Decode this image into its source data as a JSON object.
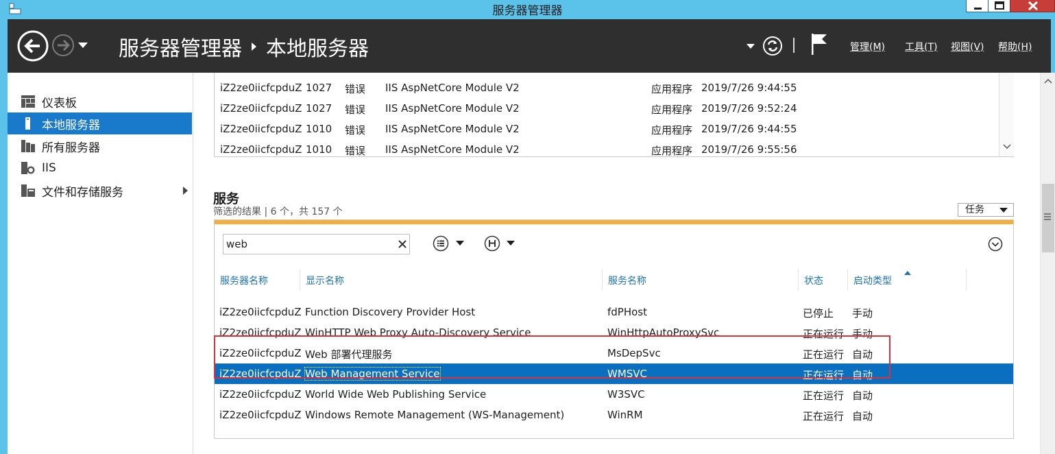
{
  "window": {
    "title": "服务器管理器"
  },
  "header": {
    "breadcrumb_root": "服务器管理器",
    "breadcrumb_current": "本地服务器",
    "menu": [
      {
        "label": "管理(M)"
      },
      {
        "label": "工具(T)"
      },
      {
        "label": "视图(V)"
      },
      {
        "label": "帮助(H)"
      }
    ]
  },
  "sidebar": {
    "items": [
      {
        "label": "仪表板",
        "icon": "dashboard-icon"
      },
      {
        "label": "本地服务器",
        "icon": "local-server-icon",
        "active": true
      },
      {
        "label": "所有服务器",
        "icon": "all-servers-icon"
      },
      {
        "label": "IIS",
        "icon": "iis-icon"
      },
      {
        "label": "文件和存储服务",
        "icon": "file-storage-icon",
        "expandable": true
      }
    ]
  },
  "events": {
    "rows": [
      {
        "server": "iZ2ze0iicfcpduZ",
        "id": "1027",
        "severity": "错误",
        "source": "IIS AspNetCore Module V2",
        "log": "应用程序",
        "time": "2019/7/26 9:44:55"
      },
      {
        "server": "iZ2ze0iicfcpduZ",
        "id": "1027",
        "severity": "错误",
        "source": "IIS AspNetCore Module V2",
        "log": "应用程序",
        "time": "2019/7/26 9:52:24"
      },
      {
        "server": "iZ2ze0iicfcpduZ",
        "id": "1010",
        "severity": "错误",
        "source": "IIS AspNetCore Module V2",
        "log": "应用程序",
        "time": "2019/7/26 9:44:55"
      },
      {
        "server": "iZ2ze0iicfcpduZ",
        "id": "1010",
        "severity": "错误",
        "source": "IIS AspNetCore Module V2",
        "log": "应用程序",
        "time": "2019/7/26 9:55:56"
      }
    ]
  },
  "services": {
    "title": "服务",
    "subtitle": "筛选的结果 | 6 个，共 157 个",
    "tasks_label": "任务",
    "search_value": "web",
    "columns": [
      "服务器名称",
      "显示名称",
      "服务名称",
      "状态",
      "启动类型"
    ],
    "rows": [
      {
        "server": "iZ2ze0iicfcpduZ",
        "display": "Function Discovery Provider Host",
        "name": "fdPHost",
        "status": "已停止",
        "startup": "手动"
      },
      {
        "server": "iZ2ze0iicfcpduZ",
        "display": "WinHTTP Web Proxy Auto-Discovery Service",
        "name": "WinHttpAutoProxySvc",
        "status": "正在运行",
        "startup": "手动"
      },
      {
        "server": "iZ2ze0iicfcpduZ",
        "display": "Web 部署代理服务",
        "name": "MsDepSvc",
        "status": "正在运行",
        "startup": "自动"
      },
      {
        "server": "iZ2ze0iicfcpduZ",
        "display": "Web Management Service",
        "name": "WMSVC",
        "status": "正在运行",
        "startup": "自动",
        "selected": true
      },
      {
        "server": "iZ2ze0iicfcpduZ",
        "display": "World Wide Web Publishing Service",
        "name": "W3SVC",
        "status": "正在运行",
        "startup": "自动"
      },
      {
        "server": "iZ2ze0iicfcpduZ",
        "display": "Windows Remote Management (WS-Management)",
        "name": "WinRM",
        "status": "正在运行",
        "startup": "自动"
      }
    ]
  },
  "colors": {
    "titlebar": "#5bc3ea",
    "header": "#2f2f2f",
    "selection": "#0a6fbf",
    "accent": "#f6ad39",
    "highlight": "#d9333a"
  }
}
